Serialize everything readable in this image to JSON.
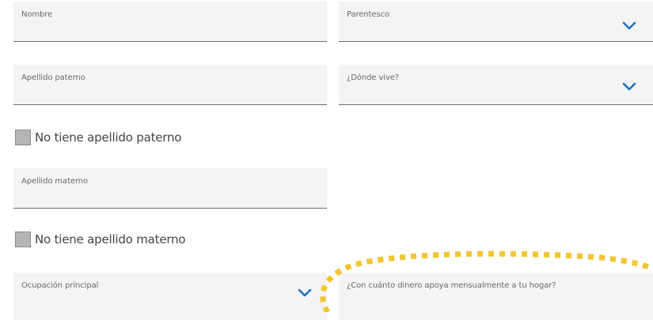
{
  "form": {
    "nombre": {
      "label": "Nombre"
    },
    "parentesco": {
      "label": "Parentesco"
    },
    "apellido_paterno": {
      "label": "Apellido paterno"
    },
    "donde_vive": {
      "label": "¿Dónde vive?"
    },
    "no_paterno": {
      "label": "No tiene apellido paterno",
      "checked": false
    },
    "apellido_materno": {
      "label": "Apellido materno"
    },
    "no_materno": {
      "label": "No tiene apellido materno",
      "checked": false
    },
    "ocupacion": {
      "label": "Ocupación principal"
    },
    "dinero": {
      "label": "¿Con cuánto dinero apoya mensualmente a tu hogar?"
    }
  },
  "colors": {
    "accent": "#1b72c4",
    "highlight": "#f2c531"
  },
  "icons": {
    "dropdown": "chevron-down-icon"
  }
}
